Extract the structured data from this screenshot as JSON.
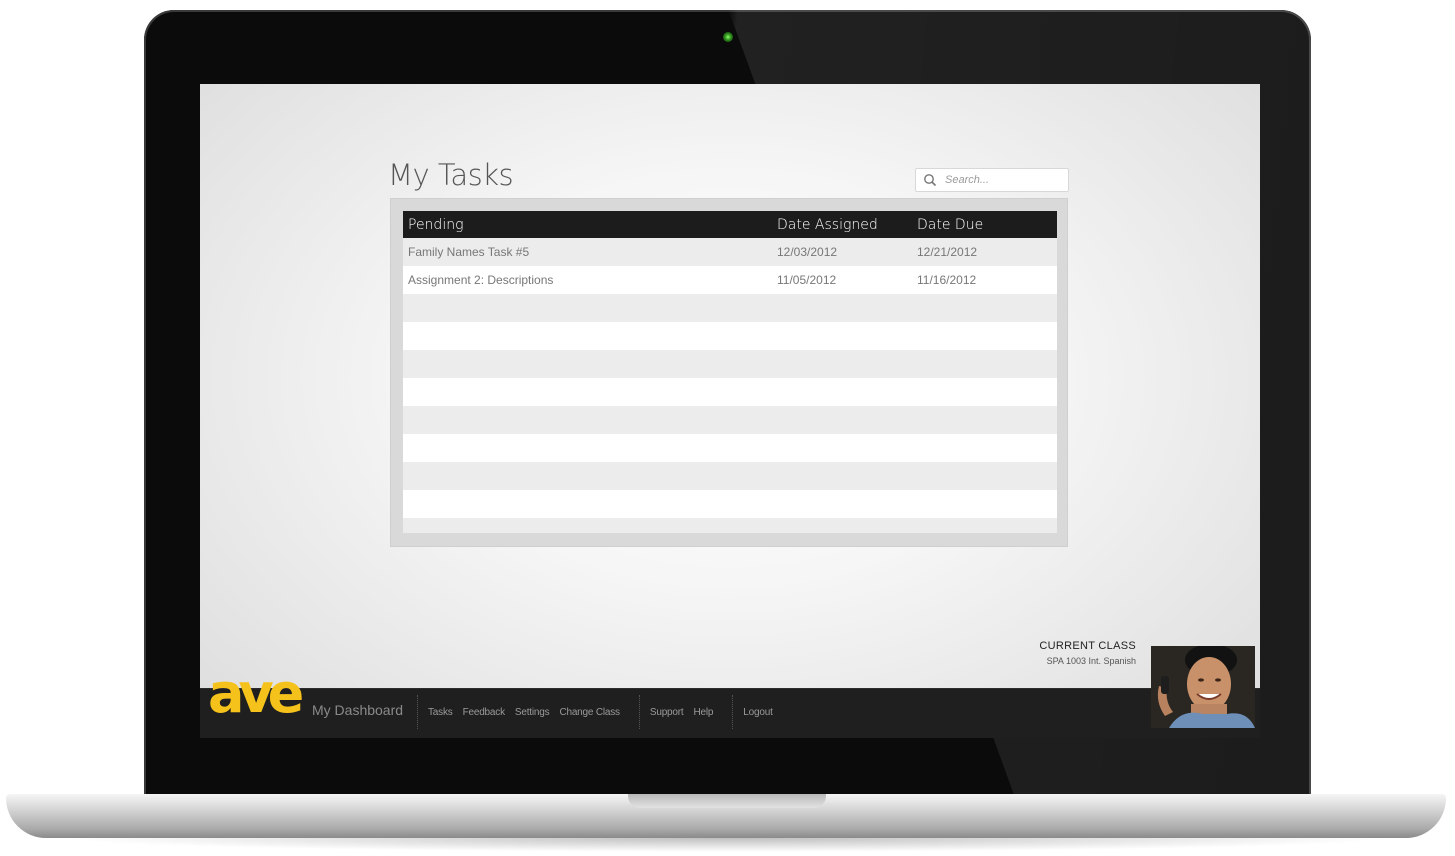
{
  "app": {
    "logo_text": "ave",
    "dashboard_label": "My Dashboard"
  },
  "page": {
    "title": "My Tasks"
  },
  "search": {
    "placeholder": "Search..."
  },
  "table": {
    "columns": [
      "Pending",
      "Date Assigned",
      "Date Due"
    ],
    "rows": [
      {
        "name": "Family Names Task #5",
        "assigned": "12/03/2012",
        "due": "12/21/2012"
      },
      {
        "name": "Assignment 2: Descriptions",
        "assigned": "11/05/2012",
        "due": "11/16/2012"
      }
    ]
  },
  "nav": {
    "items": [
      "Tasks",
      "Feedback",
      "Settings",
      "Change Class",
      "Support",
      "Help",
      "Logout"
    ]
  },
  "current_class": {
    "label": "CURRENT CLASS",
    "value": "SPA 1003 Int. Spanish"
  },
  "colors": {
    "accent": "#f5c21b",
    "bar": "#1f1f1f"
  }
}
